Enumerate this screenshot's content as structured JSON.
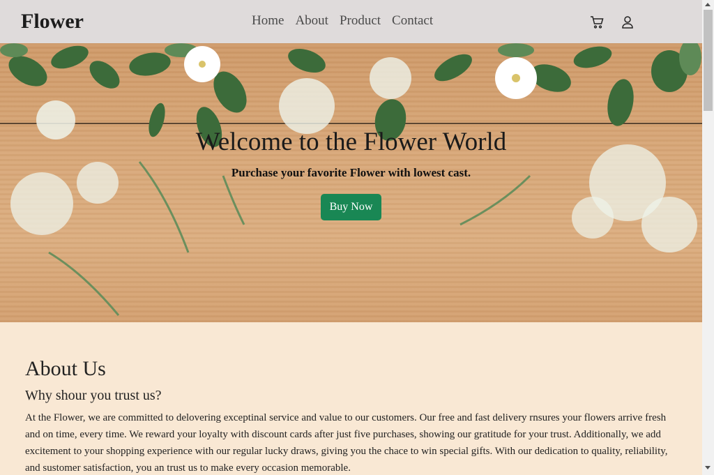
{
  "navbar": {
    "brand": "Flower",
    "links": [
      "Home",
      "About",
      "Product",
      "Contact"
    ],
    "icons": [
      "cart-icon",
      "user-icon"
    ]
  },
  "hero": {
    "title": "Welcome to the Flower World",
    "subtitle": "Purchase your favorite Flower with lowest cast.",
    "button_label": "Buy Now"
  },
  "about": {
    "title": "About Us",
    "subtitle": "Why shour you trust us?",
    "text": "At the Flower, we are committed to delovering exceptinal service and value to our customers. Our free and fast delivery rnsures your flowers arrive fresh and on time, every time. We reward your loyalty with discount cards after just five purchases, showing our gratitude for your trust. Additionally, we add excitement to your shopping experience with our regular lucky draws, giving you the chace to win special gifts. With our dedication to quality, reliability, and sustomer satisfaction, you an trust us to make every occasion memorable."
  },
  "colors": {
    "navbar_bg": "#dfdbdb",
    "button_bg": "#198754",
    "about_bg": "#f9e8d4"
  }
}
